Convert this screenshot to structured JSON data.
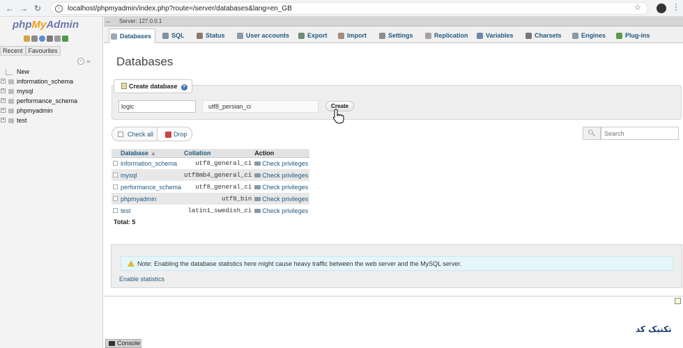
{
  "browser": {
    "url": "localhost/phpmyadmin/index.php?route=/server/databases&lang=en_GB"
  },
  "sidebar": {
    "logo": {
      "php": "php",
      "my": "My",
      "admin": "Admin"
    },
    "tabs": [
      "Recent",
      "Favourites"
    ],
    "tree": [
      {
        "label": "New"
      },
      {
        "label": "information_schema"
      },
      {
        "label": "mysql"
      },
      {
        "label": "performance_schema"
      },
      {
        "label": "phpmyadmin"
      },
      {
        "label": "test"
      }
    ]
  },
  "server_bar": {
    "label": "Server: 127.0.0.1"
  },
  "tabs": [
    {
      "label": "Databases",
      "active": true
    },
    {
      "label": "SQL"
    },
    {
      "label": "Status"
    },
    {
      "label": "User accounts"
    },
    {
      "label": "Export"
    },
    {
      "label": "Import"
    },
    {
      "label": "Settings"
    },
    {
      "label": "Replication"
    },
    {
      "label": "Variables"
    },
    {
      "label": "Charsets"
    },
    {
      "label": "Engines"
    },
    {
      "label": "Plug-ins"
    }
  ],
  "main": {
    "title": "Databases",
    "create": {
      "legend": "Create database",
      "db_name_value": "logic",
      "collation_value": "utf8_persian_ci",
      "button": "Create"
    },
    "check_all": "Check all",
    "drop": "Drop",
    "search_placeholder": "Search",
    "table": {
      "headers": {
        "database": "Database",
        "collation": "Collation",
        "action": "Action"
      },
      "rows": [
        {
          "database": "information_schema",
          "collation": "utf8_general_ci",
          "action": "Check privileges"
        },
        {
          "database": "mysql",
          "collation": "utf8mb4_general_ci",
          "action": "Check privileges"
        },
        {
          "database": "performance_schema",
          "collation": "utf8_general_ci",
          "action": "Check privileges"
        },
        {
          "database": "phpmyadmin",
          "collation": "utf8_bin",
          "action": "Check privileges"
        },
        {
          "database": "test",
          "collation": "latin1_swedish_ci",
          "action": "Check privileges"
        }
      ],
      "total": "Total: 5"
    },
    "notice": "Note: Enabling the database statistics here might cause heavy traffic between the web server and the MySQL server.",
    "enable_stats": "Enable statistics"
  },
  "console": {
    "label": "Console"
  },
  "watermark": "تکنیک کد",
  "colors": {
    "link": "#235a81",
    "logo_blue": "#6c78af",
    "logo_orange": "#f29e1a",
    "notice_bg": "#e5f6fb"
  }
}
